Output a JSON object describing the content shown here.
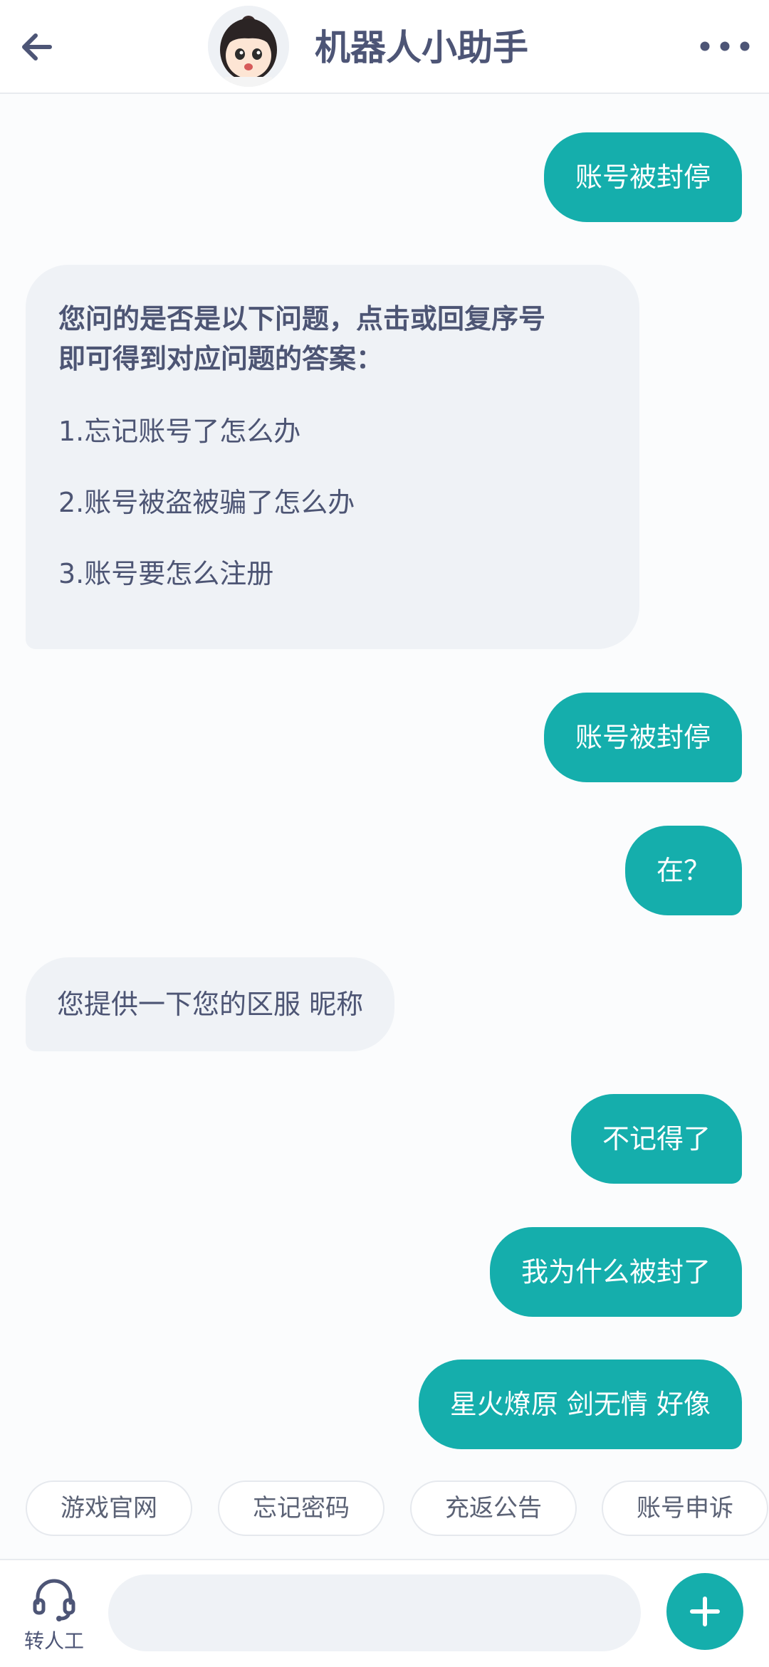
{
  "header": {
    "title": "机器人小助手",
    "icons": [
      "back-arrow-icon",
      "avatar",
      "more-dots-icon"
    ]
  },
  "messages": [
    {
      "from": "user",
      "text": "账号被封停"
    },
    {
      "from": "bot",
      "intro": "您问的是否是以下问题，点击或回复序号即可得到对应问题的答案：",
      "intro_lines": [
        "您问的是否是以下问题，点击或回复序号",
        "即可得到对应问题的答案："
      ],
      "options": [
        "1.忘记账号了怎么办",
        "2.账号被盗被骗了怎么办",
        "3.账号要怎么注册"
      ]
    },
    {
      "from": "user",
      "text": "账号被封停"
    },
    {
      "from": "user",
      "text": "在？"
    },
    {
      "from": "bot",
      "text": "您提供一下您的区服 昵称"
    },
    {
      "from": "user",
      "text": "不记得了"
    },
    {
      "from": "user",
      "text": "我为什么被封了"
    },
    {
      "from": "user",
      "text": "星火燎原 剑无情 好像"
    }
  ],
  "quick_replies": [
    "游戏官网",
    "忘记密码",
    "充返公告",
    "账号申诉"
  ],
  "bottom": {
    "human_label": "转人工",
    "input_value": "",
    "icons": [
      "headset-icon",
      "plus-icon"
    ]
  },
  "colors": {
    "accent": "#15aeac",
    "bot_bubble": "#eff2f6",
    "title_text": "#4d5576",
    "page_bg": "#fbfcfd"
  }
}
